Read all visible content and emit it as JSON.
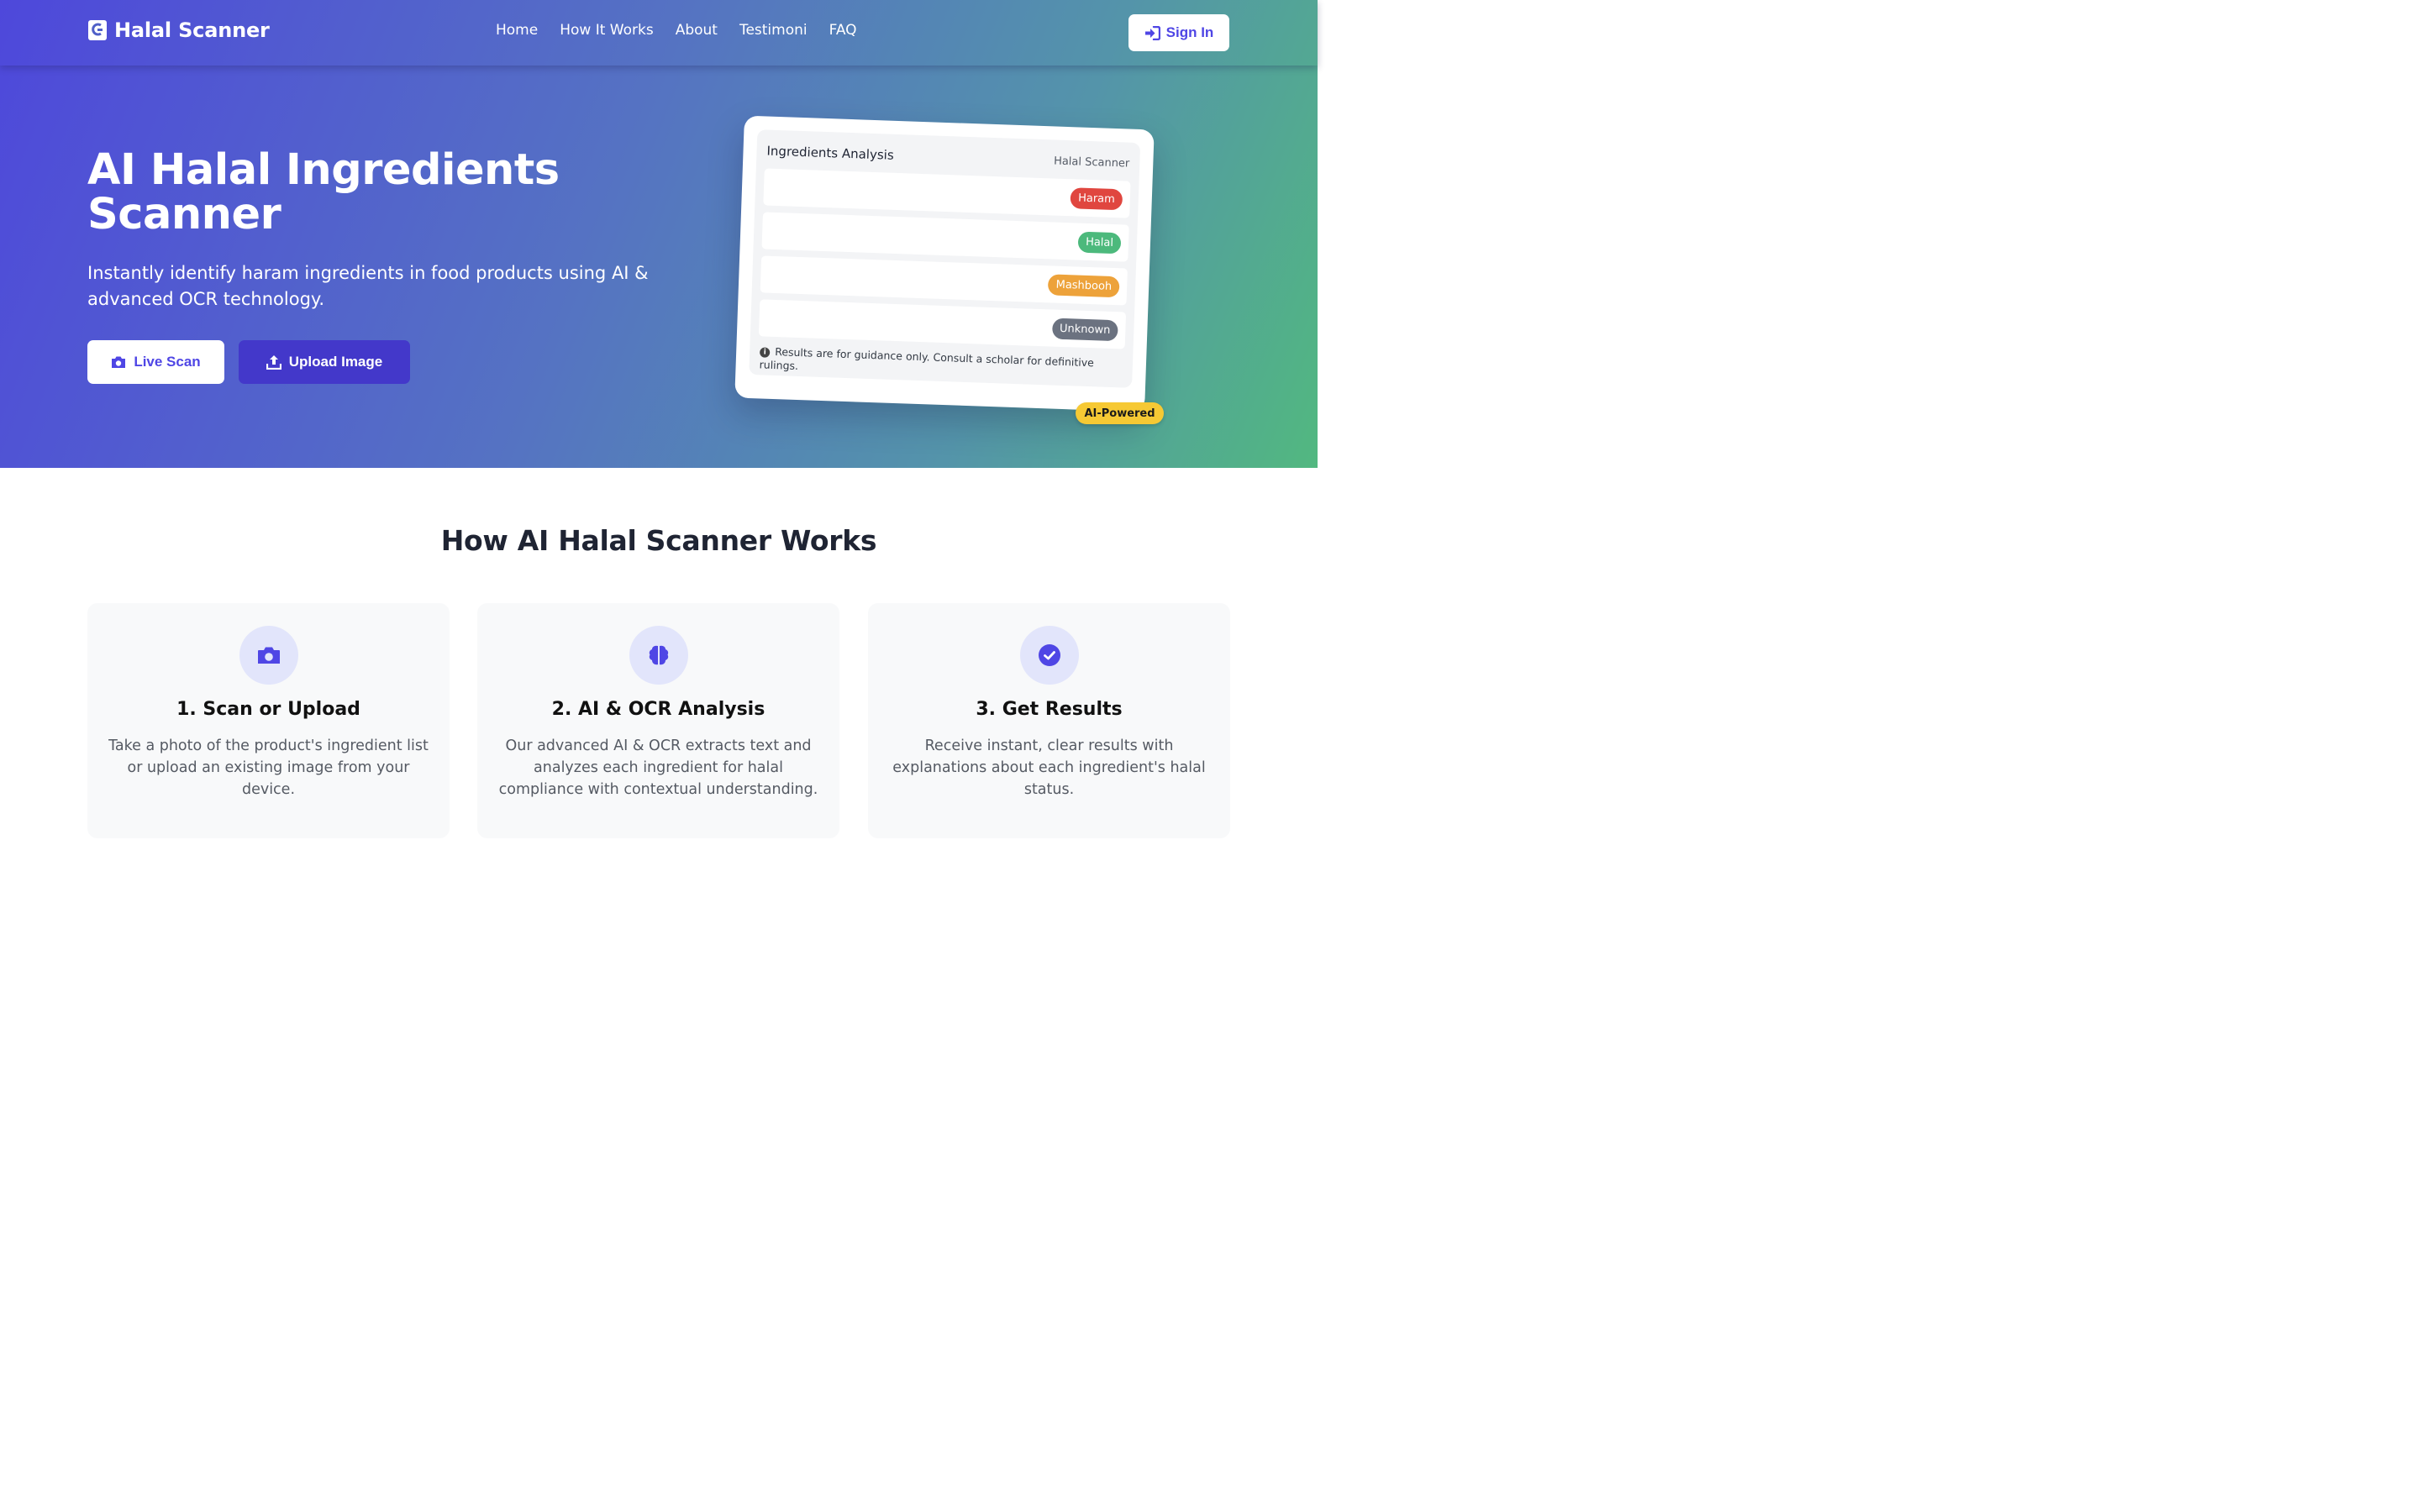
{
  "nav": {
    "brand": "Halal Scanner",
    "links": [
      "Home",
      "How It Works",
      "About",
      "Testimoni",
      "FAQ"
    ],
    "signin_label": "Sign In"
  },
  "hero": {
    "title": "AI Halal Ingredients Scanner",
    "subtitle": "Instantly identify haram ingredients in food products using AI & advanced OCR technology.",
    "live_scan_label": "Live Scan",
    "upload_label": "Upload Image"
  },
  "card": {
    "title": "Ingredients Analysis",
    "brand": "Halal Scanner",
    "badges": [
      {
        "label": "Haram",
        "color": "#e0463f"
      },
      {
        "label": "Halal",
        "color": "#4cb97c"
      },
      {
        "label": "Mashbooh",
        "color": "#eda23a"
      },
      {
        "label": "Unknown",
        "color": "#6b7280"
      }
    ],
    "note": "Results are for guidance only. Consult a scholar for definitive rulings.",
    "ai_badge": "AI-Powered"
  },
  "how": {
    "title": "How AI Halal Scanner Works",
    "steps": [
      {
        "icon": "camera-icon",
        "title": "1. Scan or Upload",
        "desc": "Take a photo of the product's ingredient list or upload an existing image from your device."
      },
      {
        "icon": "brain-icon",
        "title": "2. AI & OCR Analysis",
        "desc": "Our advanced AI & OCR extracts text and analyzes each ingredient for halal compliance with contextual understanding."
      },
      {
        "icon": "check-circle-icon",
        "title": "3. Get Results",
        "desc": "Receive instant, clear results with explanations about each ingredient's halal status."
      }
    ]
  },
  "colors": {
    "accent": "#4f46e5",
    "accent_dark": "#4338ca",
    "gradient_start": "#4e48db",
    "gradient_end": "#52b880"
  }
}
